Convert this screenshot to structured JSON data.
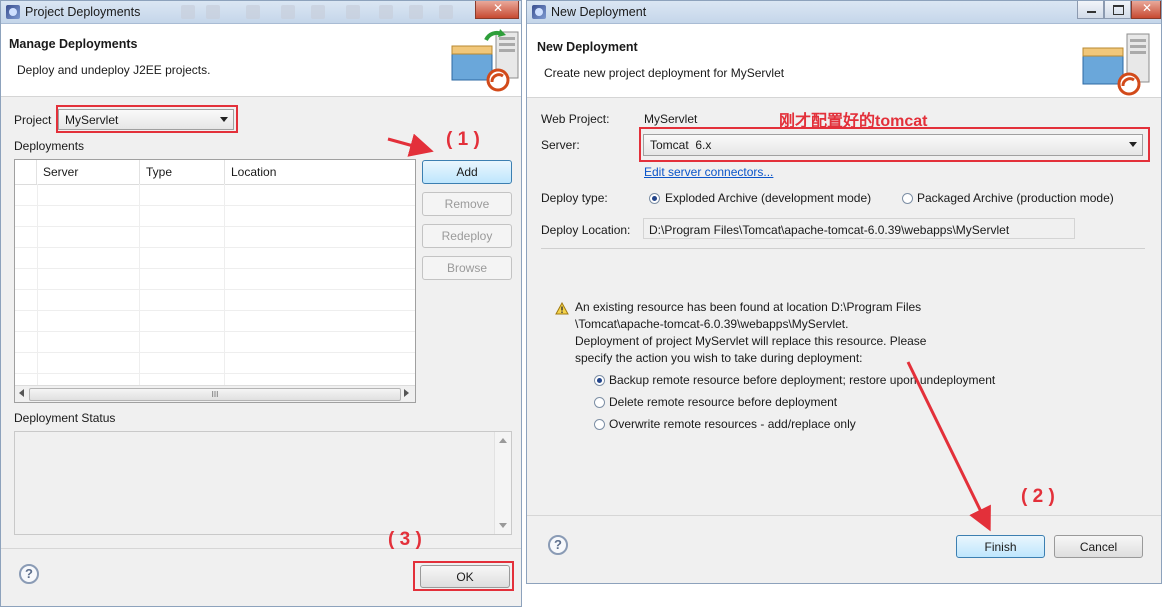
{
  "left_dialog": {
    "title": "Project Deployments",
    "header_title": "Manage Deployments",
    "header_desc": "Deploy and undeploy J2EE projects.",
    "project_label": "Project",
    "project_value": "MyServlet",
    "deployments_label": "Deployments",
    "columns": [
      "Server",
      "Type",
      "Location"
    ],
    "buttons": {
      "add": "Add",
      "remove": "Remove",
      "redeploy": "Redeploy",
      "browse": "Browse"
    },
    "scroll_thumb": "III",
    "status_label": "Deployment Status",
    "ok": "OK",
    "help": "?"
  },
  "right_dialog": {
    "title": "New Deployment",
    "header_title": "New Deployment",
    "header_desc": "Create new project deployment for MyServlet",
    "web_project_label": "Web Project:",
    "web_project_value": "MyServlet",
    "annotation": "刚才配置好的tomcat",
    "server_label": "Server:",
    "server_value": "Tomcat  6.x",
    "edit_connectors": "Edit server connectors...",
    "deploy_type_label": "Deploy type:",
    "deploy_type_options": [
      "Exploded Archive (development mode)",
      "Packaged Archive (production mode)"
    ],
    "deploy_location_label": "Deploy Location:",
    "deploy_location_value": "D:\\Program Files\\Tomcat\\apache-tomcat-6.0.39\\webapps\\MyServlet",
    "warning_lines": [
      "An existing resource has been found at location D:\\Program Files",
      "\\Tomcat\\apache-tomcat-6.0.39\\webapps\\MyServlet.",
      "Deployment of project MyServlet will replace this resource. Please",
      "specify the action you wish to take during deployment:"
    ],
    "actions": [
      "Backup remote resource before deployment; restore upon undeployment",
      "Delete remote resource before deployment",
      "Overwrite remote resources - add/replace only"
    ],
    "finish": "Finish",
    "cancel": "Cancel",
    "help": "?"
  },
  "annotations": {
    "step1": "( 1 )",
    "step2": "( 2 )",
    "step3": "( 3 )"
  },
  "colors": {
    "annotation_red": "#e3303a",
    "dialog_body": "#f0f0f0",
    "titlebar": "#c5d6ea"
  }
}
